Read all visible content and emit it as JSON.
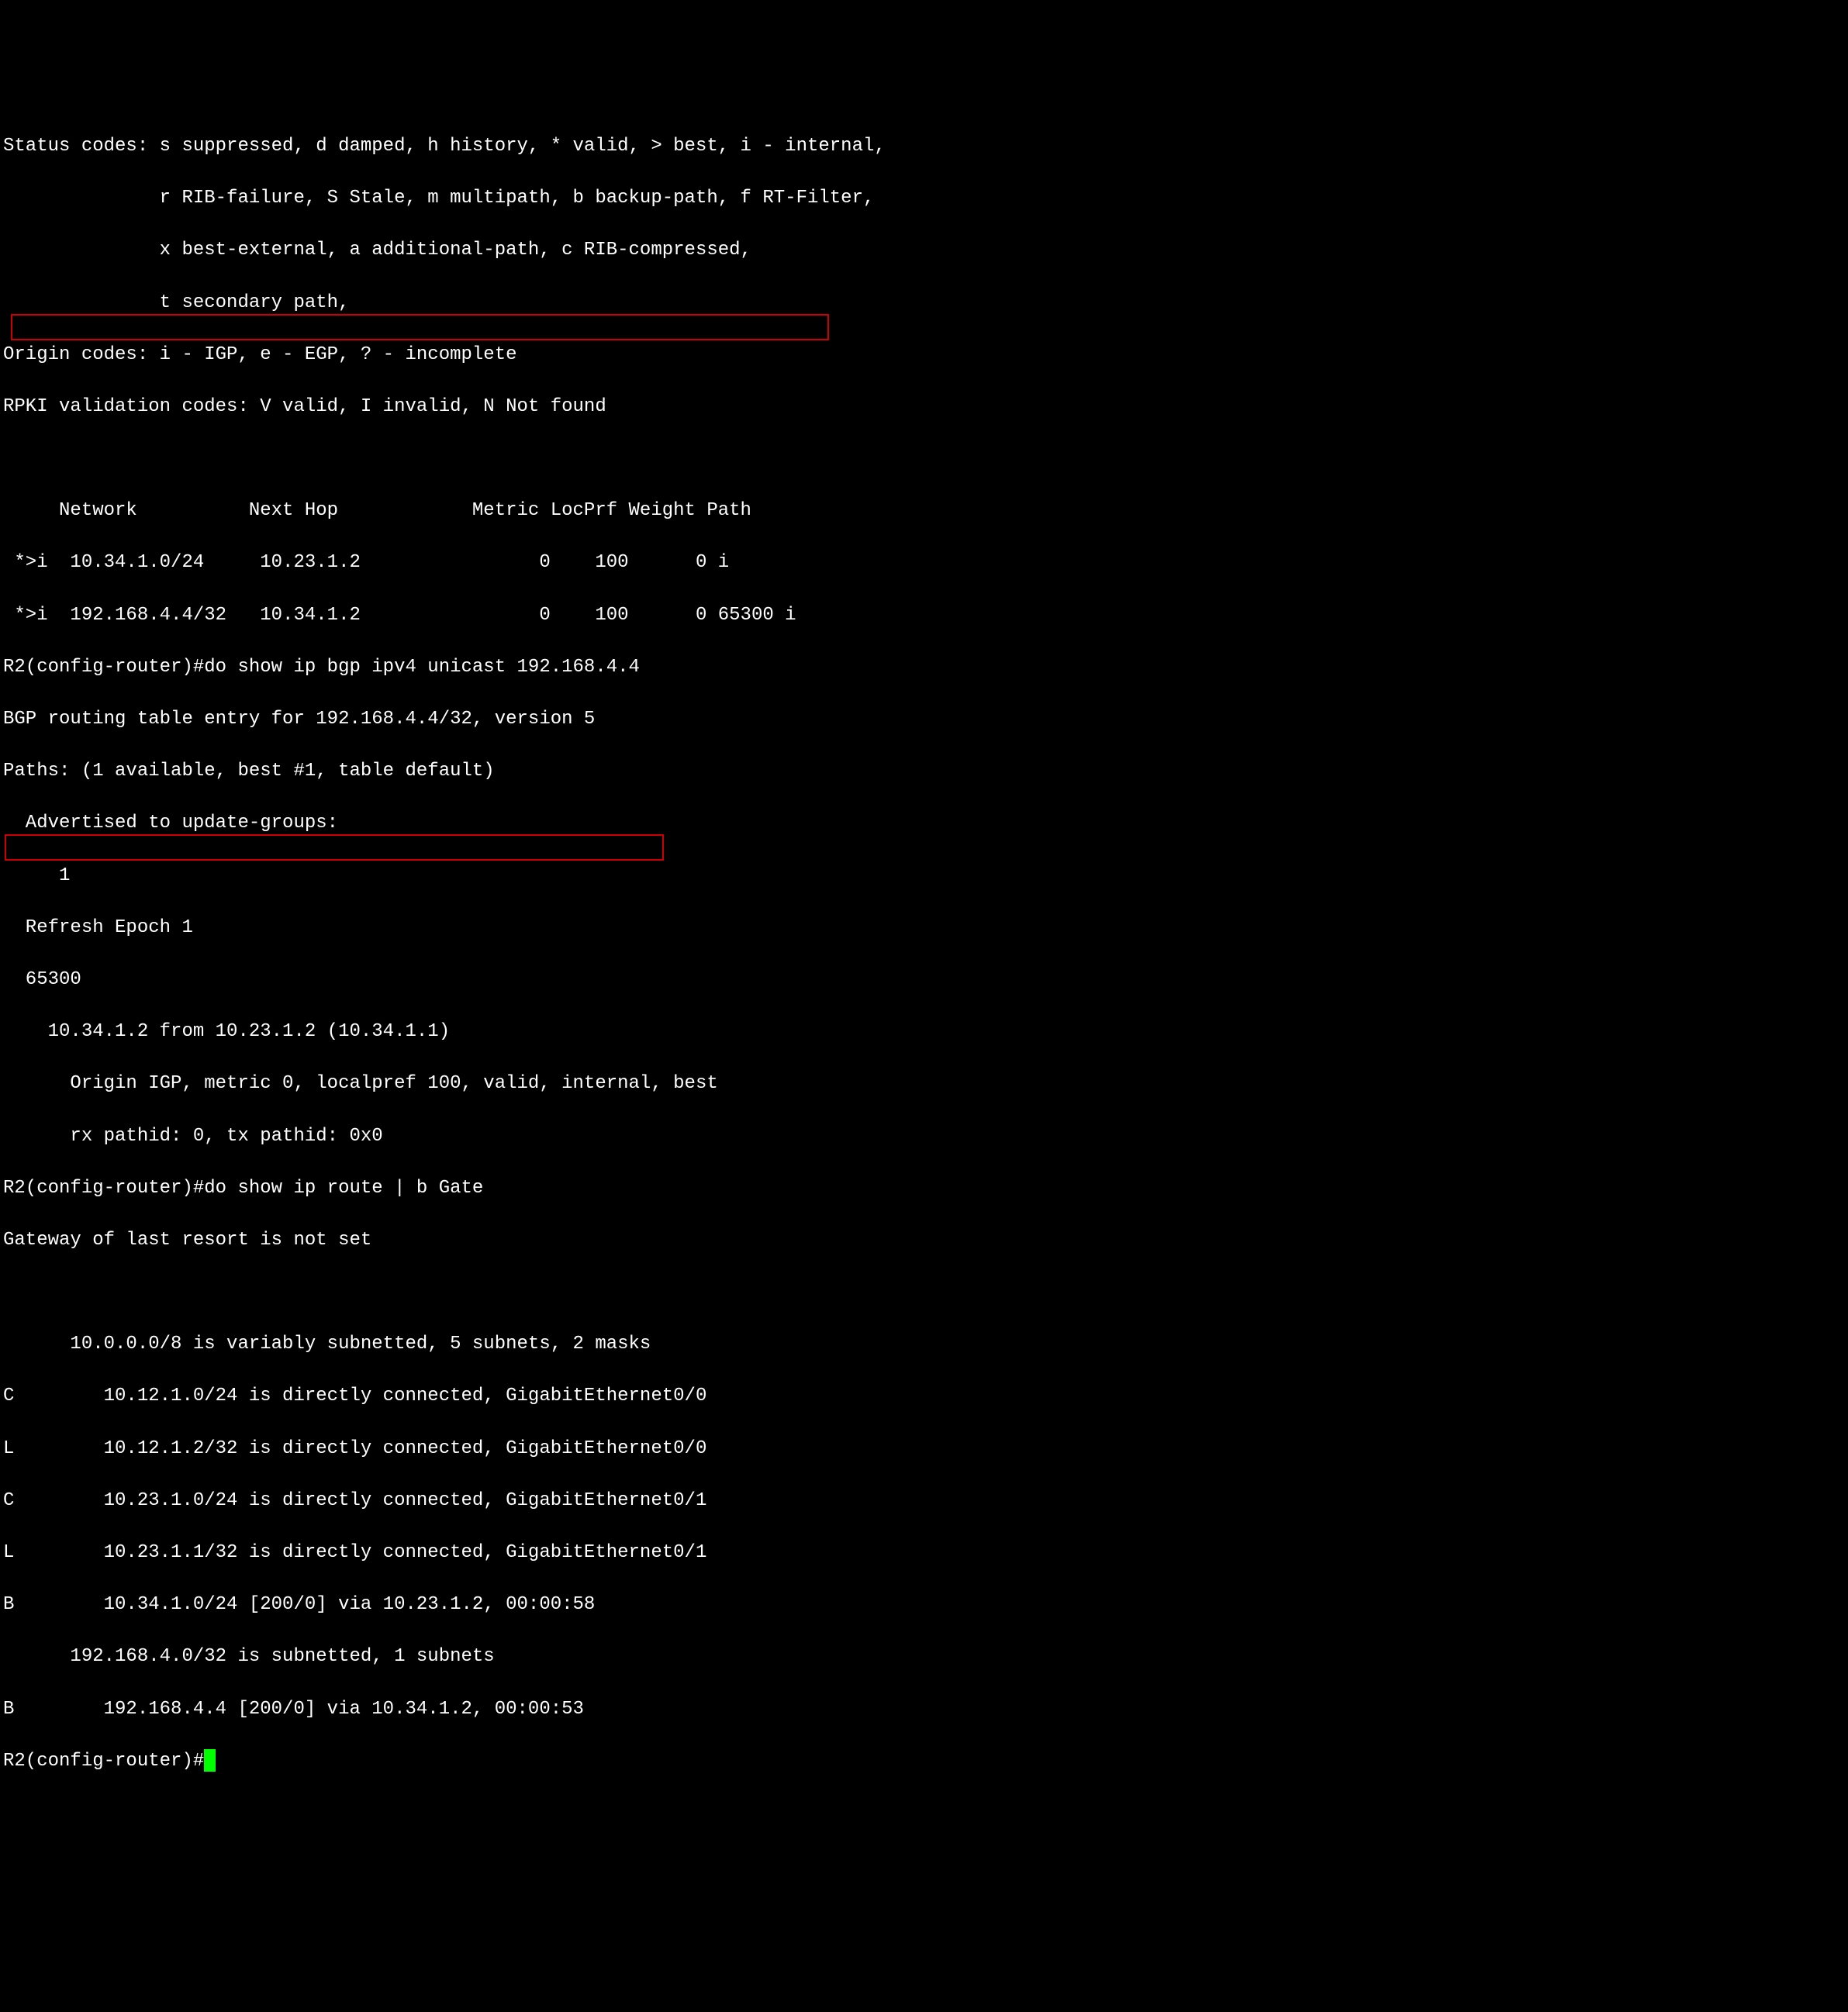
{
  "legend": {
    "status_line1": "Status codes: s suppressed, d damped, h history, * valid, > best, i - internal,",
    "status_line2": "              r RIB-failure, S Stale, m multipath, b backup-path, f RT-Filter,",
    "status_line3": "              x best-external, a additional-path, c RIB-compressed,",
    "status_line4": "              t secondary path,",
    "origin_codes": "Origin codes: i - IGP, e - EGP, ? - incomplete",
    "rpki_codes": "RPKI validation codes: V valid, I invalid, N Not found"
  },
  "bgp_table": {
    "header": "     Network          Next Hop            Metric LocPrf Weight Path",
    "row1": " *>i  10.34.1.0/24     10.23.1.2                0    100      0 i",
    "row2": " *>i  192.168.4.4/32   10.34.1.2                0    100      0 65300 i"
  },
  "cmd1": {
    "prompt_cmd": "R2(config-router)#do show ip bgp ipv4 unicast 192.168.4.4",
    "out1": "BGP routing table entry for 192.168.4.4/32, version 5",
    "out2": "Paths: (1 available, best #1, table default)",
    "out3": "  Advertised to update-groups:",
    "out4": "     1",
    "out5": "  Refresh Epoch 1",
    "out6": "  65300",
    "out7": "    10.34.1.2 from 10.23.1.2 (10.34.1.1)",
    "out8": "      Origin IGP, metric 0, localpref 100, valid, internal, best",
    "out9": "      rx pathid: 0, tx pathid: 0x0"
  },
  "cmd2": {
    "prompt_cmd": "R2(config-router)#do show ip route | b Gate",
    "out1": "Gateway of last resort is not set",
    "blank": "",
    "out2": "      10.0.0.0/8 is variably subnetted, 5 subnets, 2 masks",
    "out3": "C        10.12.1.0/24 is directly connected, GigabitEthernet0/0",
    "out4": "L        10.12.1.2/32 is directly connected, GigabitEthernet0/0",
    "out5": "C        10.23.1.0/24 is directly connected, GigabitEthernet0/1",
    "out6": "L        10.23.1.1/32 is directly connected, GigabitEthernet0/1",
    "out7": "B        10.34.1.0/24 [200/0] via 10.23.1.2, 00:00:58",
    "out8": "      192.168.4.0/32 is subnetted, 1 subnets",
    "out9": "B        192.168.4.4 [200/0] via 10.34.1.2, 00:00:53"
  },
  "final_prompt": "R2(config-router)#",
  "highlights": {
    "box1_style": "top: 267px; left: 10px; width: 1055px; height: 34px;",
    "box2_style": "top: 938px; left: 2px; width: 850px; height: 34px;"
  }
}
